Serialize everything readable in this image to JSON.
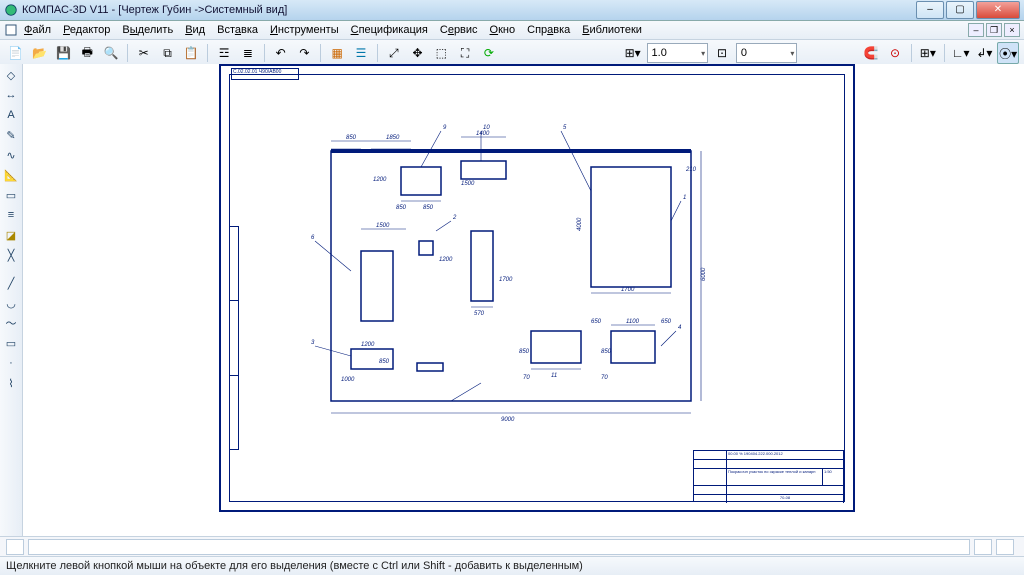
{
  "window": {
    "title": "КОМПАС-3D V11 - [Чертеж Губин ->Системный вид]"
  },
  "menu": {
    "file": "Файл",
    "edit": "Редактор",
    "select": "Выделить",
    "view": "Вид",
    "insert": "Вставка",
    "tools": "Инструменты",
    "spec": "Спецификация",
    "service": "Сервис",
    "window": "Окно",
    "help": "Справка",
    "libs": "Библиотеки"
  },
  "toolbar": {
    "scale": "1.0",
    "step": "0"
  },
  "drawing": {
    "stamp": "С.02.02.01 Ч90/АВ00",
    "titleblock_code": "00.00 % 190404.222.000.2012",
    "titleblock_name": "Покрасочн участок по окраске теплой и капарн",
    "titleblock_sheet": "70-08"
  },
  "statusbar": {
    "hint": "Щелкните левой кнопкой мыши на объекте для его выделения (вместе с Ctrl или Shift - добавить к выделенным)"
  }
}
